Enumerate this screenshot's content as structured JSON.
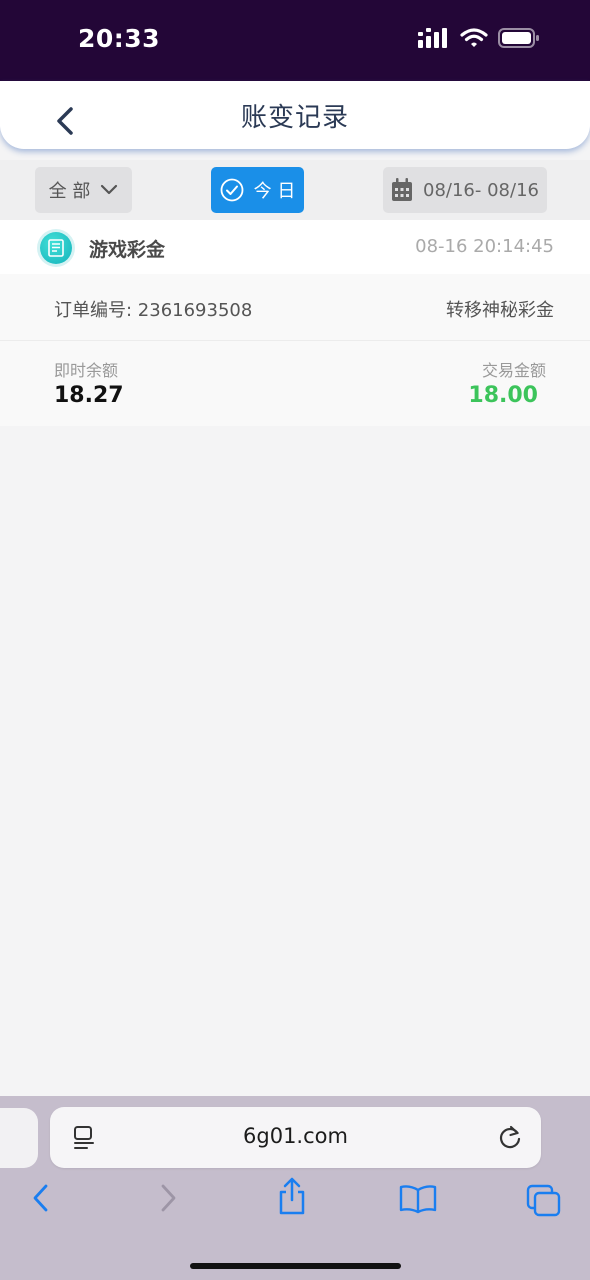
{
  "status_bar": {
    "time": "20:33"
  },
  "nav": {
    "title": "账变记录"
  },
  "filters": {
    "all_label": "全 部",
    "today_label": "今 日",
    "date_range": "08/16- 08/16"
  },
  "record": {
    "category": "游戏彩金",
    "time": "08-16 20:14:45",
    "order_label": "订单编号: 2361693508",
    "type": "转移神秘彩金",
    "balance_label": "即时余额",
    "balance_value": "18.27",
    "amount_label": "交易金额",
    "amount_value": "18.00"
  },
  "browser": {
    "url": "6g01.com"
  },
  "colors": {
    "status_bar_bg": "#230637",
    "accent_blue": "#1a8fe8",
    "amount_green": "#3cc45b",
    "icon_teal": "#15b2bb"
  }
}
